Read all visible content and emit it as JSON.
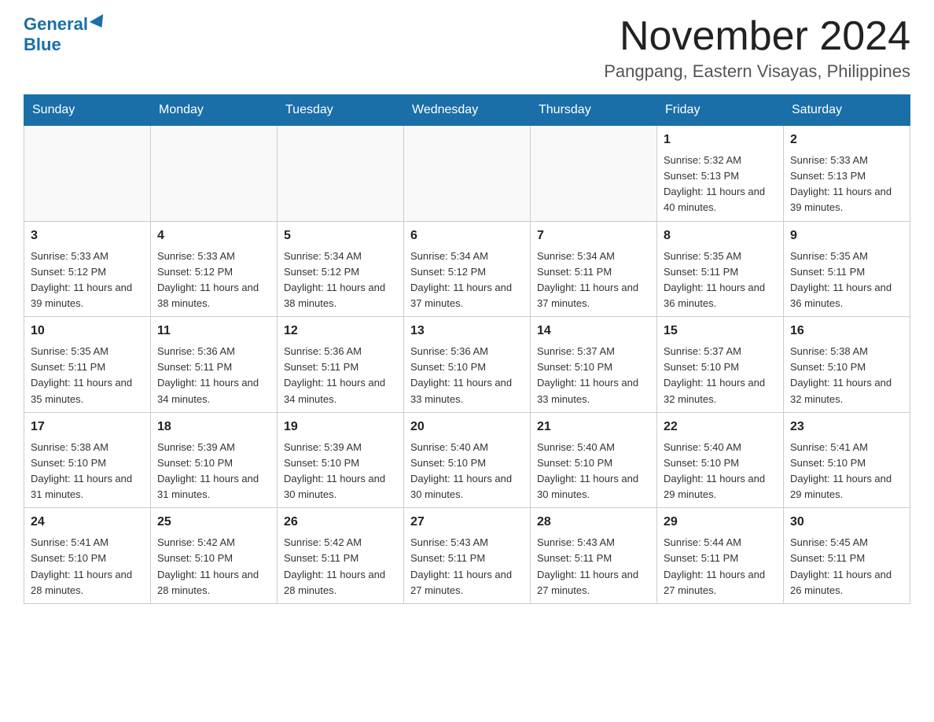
{
  "header": {
    "logo_general": "General",
    "logo_blue": "Blue",
    "month_title": "November 2024",
    "location": "Pangpang, Eastern Visayas, Philippines"
  },
  "weekdays": [
    "Sunday",
    "Monday",
    "Tuesday",
    "Wednesday",
    "Thursday",
    "Friday",
    "Saturday"
  ],
  "weeks": [
    [
      {
        "day": "",
        "info": ""
      },
      {
        "day": "",
        "info": ""
      },
      {
        "day": "",
        "info": ""
      },
      {
        "day": "",
        "info": ""
      },
      {
        "day": "",
        "info": ""
      },
      {
        "day": "1",
        "info": "Sunrise: 5:32 AM\nSunset: 5:13 PM\nDaylight: 11 hours\nand 40 minutes."
      },
      {
        "day": "2",
        "info": "Sunrise: 5:33 AM\nSunset: 5:13 PM\nDaylight: 11 hours\nand 39 minutes."
      }
    ],
    [
      {
        "day": "3",
        "info": "Sunrise: 5:33 AM\nSunset: 5:12 PM\nDaylight: 11 hours\nand 39 minutes."
      },
      {
        "day": "4",
        "info": "Sunrise: 5:33 AM\nSunset: 5:12 PM\nDaylight: 11 hours\nand 38 minutes."
      },
      {
        "day": "5",
        "info": "Sunrise: 5:34 AM\nSunset: 5:12 PM\nDaylight: 11 hours\nand 38 minutes."
      },
      {
        "day": "6",
        "info": "Sunrise: 5:34 AM\nSunset: 5:12 PM\nDaylight: 11 hours\nand 37 minutes."
      },
      {
        "day": "7",
        "info": "Sunrise: 5:34 AM\nSunset: 5:11 PM\nDaylight: 11 hours\nand 37 minutes."
      },
      {
        "day": "8",
        "info": "Sunrise: 5:35 AM\nSunset: 5:11 PM\nDaylight: 11 hours\nand 36 minutes."
      },
      {
        "day": "9",
        "info": "Sunrise: 5:35 AM\nSunset: 5:11 PM\nDaylight: 11 hours\nand 36 minutes."
      }
    ],
    [
      {
        "day": "10",
        "info": "Sunrise: 5:35 AM\nSunset: 5:11 PM\nDaylight: 11 hours\nand 35 minutes."
      },
      {
        "day": "11",
        "info": "Sunrise: 5:36 AM\nSunset: 5:11 PM\nDaylight: 11 hours\nand 34 minutes."
      },
      {
        "day": "12",
        "info": "Sunrise: 5:36 AM\nSunset: 5:11 PM\nDaylight: 11 hours\nand 34 minutes."
      },
      {
        "day": "13",
        "info": "Sunrise: 5:36 AM\nSunset: 5:10 PM\nDaylight: 11 hours\nand 33 minutes."
      },
      {
        "day": "14",
        "info": "Sunrise: 5:37 AM\nSunset: 5:10 PM\nDaylight: 11 hours\nand 33 minutes."
      },
      {
        "day": "15",
        "info": "Sunrise: 5:37 AM\nSunset: 5:10 PM\nDaylight: 11 hours\nand 32 minutes."
      },
      {
        "day": "16",
        "info": "Sunrise: 5:38 AM\nSunset: 5:10 PM\nDaylight: 11 hours\nand 32 minutes."
      }
    ],
    [
      {
        "day": "17",
        "info": "Sunrise: 5:38 AM\nSunset: 5:10 PM\nDaylight: 11 hours\nand 31 minutes."
      },
      {
        "day": "18",
        "info": "Sunrise: 5:39 AM\nSunset: 5:10 PM\nDaylight: 11 hours\nand 31 minutes."
      },
      {
        "day": "19",
        "info": "Sunrise: 5:39 AM\nSunset: 5:10 PM\nDaylight: 11 hours\nand 30 minutes."
      },
      {
        "day": "20",
        "info": "Sunrise: 5:40 AM\nSunset: 5:10 PM\nDaylight: 11 hours\nand 30 minutes."
      },
      {
        "day": "21",
        "info": "Sunrise: 5:40 AM\nSunset: 5:10 PM\nDaylight: 11 hours\nand 30 minutes."
      },
      {
        "day": "22",
        "info": "Sunrise: 5:40 AM\nSunset: 5:10 PM\nDaylight: 11 hours\nand 29 minutes."
      },
      {
        "day": "23",
        "info": "Sunrise: 5:41 AM\nSunset: 5:10 PM\nDaylight: 11 hours\nand 29 minutes."
      }
    ],
    [
      {
        "day": "24",
        "info": "Sunrise: 5:41 AM\nSunset: 5:10 PM\nDaylight: 11 hours\nand 28 minutes."
      },
      {
        "day": "25",
        "info": "Sunrise: 5:42 AM\nSunset: 5:10 PM\nDaylight: 11 hours\nand 28 minutes."
      },
      {
        "day": "26",
        "info": "Sunrise: 5:42 AM\nSunset: 5:11 PM\nDaylight: 11 hours\nand 28 minutes."
      },
      {
        "day": "27",
        "info": "Sunrise: 5:43 AM\nSunset: 5:11 PM\nDaylight: 11 hours\nand 27 minutes."
      },
      {
        "day": "28",
        "info": "Sunrise: 5:43 AM\nSunset: 5:11 PM\nDaylight: 11 hours\nand 27 minutes."
      },
      {
        "day": "29",
        "info": "Sunrise: 5:44 AM\nSunset: 5:11 PM\nDaylight: 11 hours\nand 27 minutes."
      },
      {
        "day": "30",
        "info": "Sunrise: 5:45 AM\nSunset: 5:11 PM\nDaylight: 11 hours\nand 26 minutes."
      }
    ]
  ]
}
